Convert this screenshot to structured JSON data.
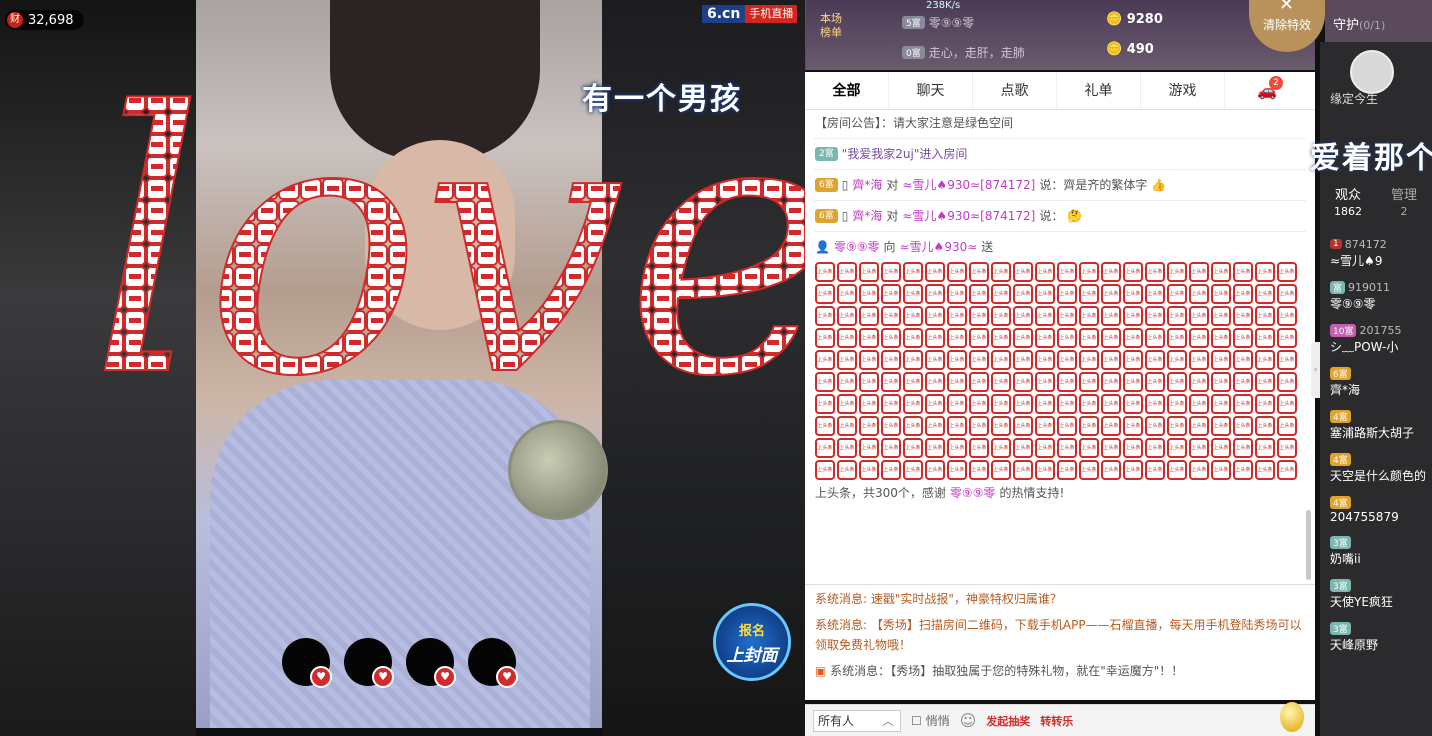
{
  "wealth": {
    "count": "32,698",
    "icon": "财"
  },
  "brand": {
    "name": "6.cn",
    "sub": "手机直播"
  },
  "lyrics": {
    "left": "有一个男孩",
    "right": "爱着那个"
  },
  "love_text": "love",
  "gift_tile_label": "上头条",
  "signup": {
    "line1": "报名",
    "line2": "上封面"
  },
  "top": {
    "rank_label": "本场\n榜单",
    "speed": "238K/s",
    "rows": [
      {
        "badge": "5富",
        "name": "零⑨⑨零",
        "value": "9280"
      },
      {
        "badge": "0富",
        "name": "走心，走肝，走肺",
        "value": "490"
      }
    ],
    "clear_btn": "清除特效",
    "guard": "守护",
    "guard_count": "(0/1)"
  },
  "tabs": [
    "全部",
    "聊天",
    "点歌",
    "礼单",
    "游戏"
  ],
  "car_badge": "2",
  "chat": {
    "notice": "【房间公告】：请大家注意是绿色空间",
    "enter": {
      "lv": "2富",
      "name": "\"我爱我家2uj\"进入房间"
    },
    "msg1": {
      "lv": "6富",
      "from": "齊*海",
      "to": "≈雪儿♠930≈[874172]",
      "text": "说：齊是齐的繁体字"
    },
    "msg2": {
      "lv": "6富",
      "from": "齊*海",
      "to": "≈雪儿♠930≈[874172]",
      "text": "说："
    },
    "gift": {
      "from": "零⑨⑨零",
      "verb": "向",
      "to": "≈雪儿♠930≈",
      "send": "送"
    },
    "thanks": {
      "text": "上头条，共300个，感谢",
      "user": "零⑨⑨零",
      "end": "的热情支持!"
    }
  },
  "sys": [
    {
      "tag": "系统消息:",
      "text": "速戳\"实时战报\"，神豪特权归属谁？"
    },
    {
      "tag": "系统消息:",
      "text": "【秀场】扫描房间二维码，下载手机APP——石榴直播，每天用手机登陆秀场可以领取免费礼物哦！"
    },
    {
      "tag": "系统消息：",
      "text": "【秀场】抽取独属于您的特殊礼物，就在\"幸运魔方\"！！"
    }
  ],
  "input": {
    "target": "所有人",
    "private": "悄悄",
    "lottery": "发起抽奖",
    "spin": "转转乐"
  },
  "audience": {
    "host": "缘定今生",
    "tab_audience": "观众",
    "audience_count": "1862",
    "tab_admin": "管理",
    "admin_count": "2",
    "items": [
      {
        "lv": "1",
        "id": "874172",
        "name": "≈雪儿♠9"
      },
      {
        "lv": "富",
        "id": "919011",
        "name": "零⑨⑨零"
      },
      {
        "lv": "10富",
        "id": "201755",
        "name": "シ﹏POW-小"
      },
      {
        "lv": "6富",
        "id": "",
        "name": "齊*海"
      },
      {
        "lv": "4富",
        "id": "",
        "name": "塞浦路斯大胡子"
      },
      {
        "lv": "4富",
        "id": "",
        "name": "天空是什么颜色的"
      },
      {
        "lv": "4富",
        "id": "",
        "name": "204755879"
      },
      {
        "lv": "3富",
        "id": "",
        "name": "奶嘴ii"
      },
      {
        "lv": "3富",
        "id": "",
        "name": "天使YE疯狂"
      },
      {
        "lv": "3富",
        "id": "",
        "name": "天峰原野"
      }
    ]
  }
}
